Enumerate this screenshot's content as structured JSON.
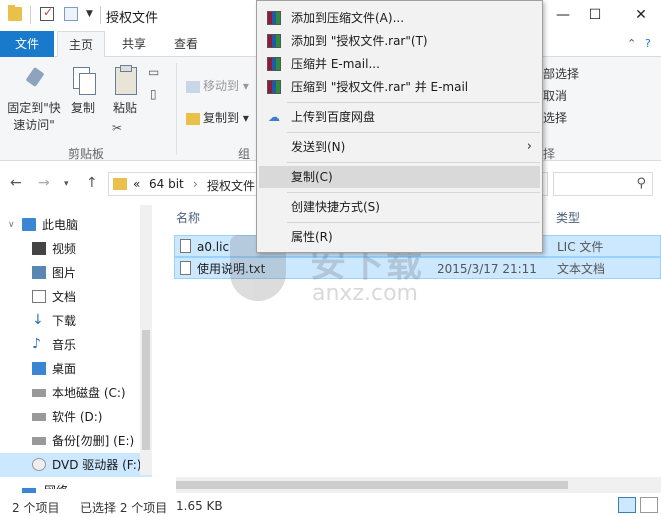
{
  "window": {
    "title": "授权文件",
    "minimize_icon": "—",
    "maximize_icon": "☐",
    "close_icon": "✕"
  },
  "ribbon_tabs": {
    "file": "文件",
    "home": "主页",
    "share": "共享",
    "view": "查看"
  },
  "ribbon": {
    "pin_label_1": "固定到\"快",
    "pin_label_2": "速访问\"",
    "copy_label": "复制",
    "paste_label": "粘贴",
    "move_to": "移动到",
    "copy_to": "复制到",
    "clipboard_group": "剪贴板",
    "organize_group_partial": "组",
    "select_group_partial": "择",
    "select_all_partial": "部选择",
    "select_none_partial": "取消",
    "invert_selection_partial": "选择"
  },
  "addressbar": {
    "crumb_prefix": "«",
    "crumb_1": "64 bit",
    "crumb_sep": "›",
    "crumb_2": "授权文件"
  },
  "navpane": {
    "items": [
      {
        "label": "此电脑"
      },
      {
        "label": "视频"
      },
      {
        "label": "图片"
      },
      {
        "label": "文档"
      },
      {
        "label": "下载"
      },
      {
        "label": "音乐"
      },
      {
        "label": "桌面"
      },
      {
        "label": "本地磁盘 (C:)"
      },
      {
        "label": "软件 (D:)"
      },
      {
        "label": "备份[勿删] (E:)"
      },
      {
        "label": "DVD 驱动器 (F:)"
      },
      {
        "label": "网络"
      }
    ]
  },
  "filelist": {
    "columns": {
      "name": "名称",
      "type": "类型"
    },
    "files": [
      {
        "name": "a0.lic",
        "date": "",
        "type": "LIC 文件"
      },
      {
        "name": "使用说明.txt",
        "date": "2015/3/17 21:11",
        "type": "文本文档"
      }
    ]
  },
  "statusbar": {
    "count": "2 个项目",
    "selected": "已选择 2 个项目",
    "size": "1.65 KB"
  },
  "context_menu": {
    "items": [
      {
        "label": "添加到压缩文件(A)...",
        "icon": "winrar-icon"
      },
      {
        "label": "添加到 \"授权文件.rar\"(T)",
        "icon": "winrar-icon"
      },
      {
        "label": "压缩并 E-mail...",
        "icon": "winrar-icon"
      },
      {
        "label": "压缩到 \"授权文件.rar\" 并 E-mail",
        "icon": "winrar-icon"
      },
      {
        "label": "上传到百度网盘",
        "icon": "baidu-cloud-icon"
      },
      {
        "label": "发送到(N)",
        "icon": ""
      },
      {
        "label": "复制(C)",
        "icon": ""
      },
      {
        "label": "创建快捷方式(S)",
        "icon": ""
      },
      {
        "label": "属性(R)",
        "icon": ""
      }
    ]
  },
  "watermark": {
    "text": "安下载",
    "sub": "anxz.com"
  },
  "colors": {
    "accent": "#1979ca",
    "selection": "#cce8ff",
    "menu_bg": "#f2f2f2"
  }
}
